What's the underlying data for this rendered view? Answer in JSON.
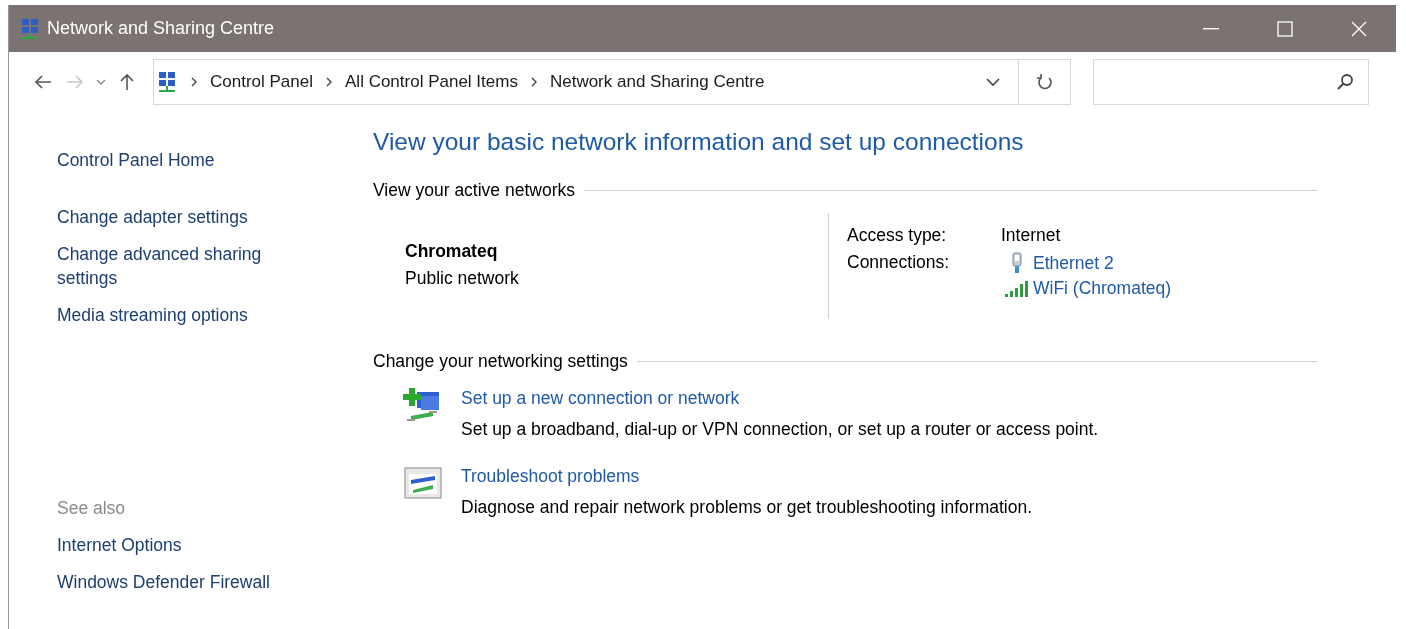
{
  "window": {
    "title": "Network and Sharing Centre"
  },
  "navigation": {
    "back": {
      "disabled": false
    },
    "forward": {
      "disabled": true
    },
    "up": {
      "disabled": false
    }
  },
  "address_bar": {
    "breadcrumbs": [
      "Control Panel",
      "All Control Panel Items",
      "Network and Sharing Centre"
    ]
  },
  "sidebar": {
    "links": [
      "Control Panel Home",
      "Change adapter settings",
      "Change advanced sharing settings",
      "Media streaming options"
    ],
    "see_also": {
      "label": "See also",
      "links": [
        "Internet Options",
        "Windows Defender Firewall"
      ]
    }
  },
  "main": {
    "heading": "View your basic network information and set up connections",
    "active_networks": {
      "section_title": "View your active networks",
      "network": {
        "name": "Chromateq",
        "category": "Public network"
      },
      "access_type": {
        "label": "Access type:",
        "value": "Internet"
      },
      "connections": {
        "label": "Connections:",
        "items": [
          {
            "kind": "ethernet",
            "name": "Ethernet 2"
          },
          {
            "kind": "wifi",
            "name": "WiFi (Chromateq)"
          }
        ]
      }
    },
    "networking_settings": {
      "section_title": "Change your networking settings",
      "tasks": [
        {
          "kind": "new-connection",
          "title": "Set up a new connection or network",
          "description": "Set up a broadband, dial-up or VPN connection, or set up a router or access point."
        },
        {
          "kind": "troubleshoot",
          "title": "Troubleshoot problems",
          "description": "Diagnose and repair network problems or get troubleshooting information."
        }
      ]
    }
  }
}
